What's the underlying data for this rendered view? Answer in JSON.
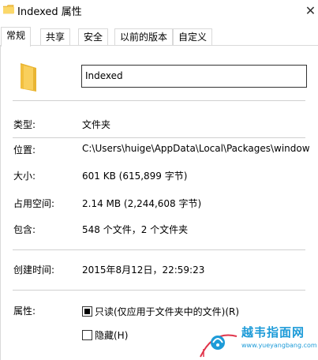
{
  "window": {
    "title": "Indexed 属性",
    "close_label": "✕"
  },
  "tabs": [
    {
      "label": "常规",
      "active": true
    },
    {
      "label": "共享",
      "active": false
    },
    {
      "label": "安全",
      "active": false
    },
    {
      "label": "以前的版本",
      "active": false
    },
    {
      "label": "自定义",
      "active": false
    }
  ],
  "general": {
    "name_value": "Indexed",
    "rows": [
      {
        "label": "类型:",
        "value": "文件夹"
      },
      {
        "label": "位置:",
        "value": "C:\\Users\\huige\\AppData\\Local\\Packages\\window"
      },
      {
        "label": "大小:",
        "value": "601 KB (615,899 字节)"
      },
      {
        "label": "占用空间:",
        "value": "2.14 MB (2,244,608 字节)"
      },
      {
        "label": "包含:",
        "value": "548 个文件，2 个文件夹"
      }
    ],
    "created": {
      "label": "创建时间:",
      "value": "2015年8月12日，22:59:23"
    },
    "attributes": {
      "label": "属性:",
      "readonly_label": "只读(仅应用于文件夹中的文件)(R)",
      "readonly_checked": true,
      "hidden_label": "隐藏(H)",
      "hidden_checked": false
    }
  },
  "watermark": {
    "text": "越韦指面网",
    "url": "www.yueyangbang.com"
  },
  "colors": {
    "border": "#d9d9d9",
    "separator": "#d0d0d0",
    "folder_yellow": "#f4c44e",
    "watermark_blue": "#1d9bd8",
    "watermark_red": "#e0344a"
  }
}
